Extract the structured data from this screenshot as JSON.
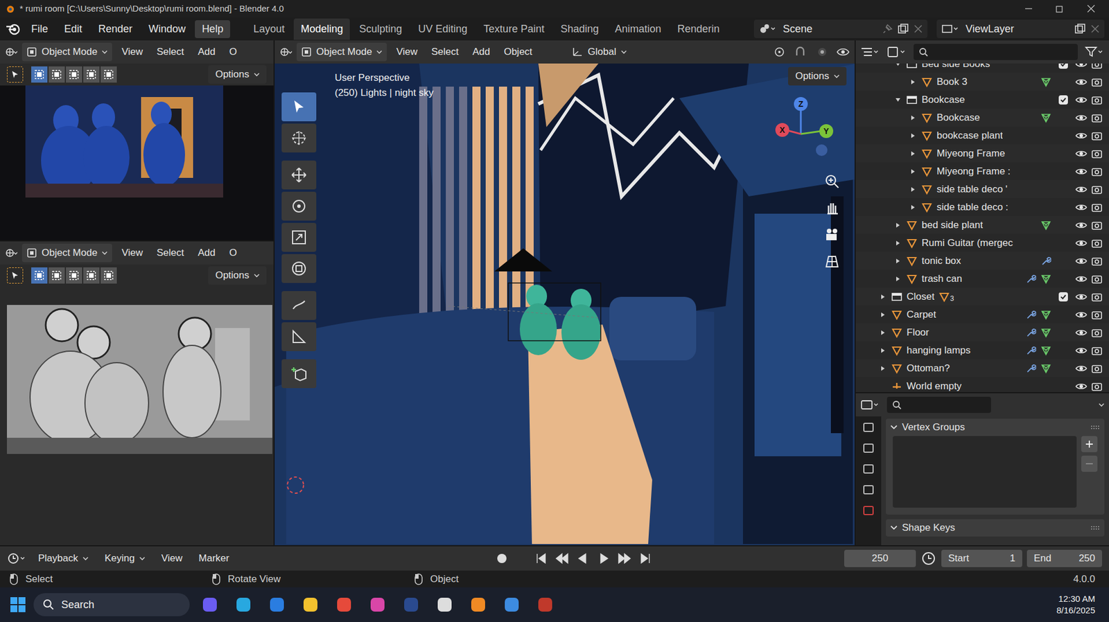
{
  "window": {
    "title": "* rumi room [C:\\Users\\Sunny\\Desktop\\rumi room.blend] - Blender 4.0"
  },
  "menu": [
    {
      "label": "File",
      "selected": false
    },
    {
      "label": "Edit",
      "selected": false
    },
    {
      "label": "Render",
      "selected": false
    },
    {
      "label": "Window",
      "selected": false
    },
    {
      "label": "Help",
      "selected": true
    }
  ],
  "workspaces": [
    {
      "label": "Layout",
      "selected": false
    },
    {
      "label": "Modeling",
      "selected": true
    },
    {
      "label": "Sculpting",
      "selected": false
    },
    {
      "label": "UV Editing",
      "selected": false
    },
    {
      "label": "Texture Paint",
      "selected": false
    },
    {
      "label": "Shading",
      "selected": false
    },
    {
      "label": "Animation",
      "selected": false
    },
    {
      "label": "Renderin",
      "selected": false
    }
  ],
  "scene": "Scene",
  "view_layer": "ViewLayer",
  "side_viewports": [
    {
      "mode": "Object Mode",
      "menus": [
        "View",
        "Select",
        "Add",
        "O"
      ],
      "options": "Options",
      "kind": "render"
    },
    {
      "mode": "Object Mode",
      "menus": [
        "View",
        "Select",
        "Add",
        "O"
      ],
      "options": "Options",
      "kind": "clay"
    }
  ],
  "main_viewport": {
    "mode": "Object Mode",
    "menus": [
      "View",
      "Select",
      "Add",
      "Object"
    ],
    "orientation": "Global",
    "options": "Options",
    "overlay": [
      "User Perspective",
      "(250) Lights | night sky"
    ],
    "gizmo": {
      "x": "X",
      "y": "Y",
      "z": "Z"
    }
  },
  "outliner": {
    "rows": [
      {
        "name": "Bed side Books",
        "depth": 1,
        "kind": "collection",
        "expandable": true,
        "expanded": true,
        "checked": true,
        "modifier": false,
        "mesh_data": false,
        "visible": true,
        "renderable": true
      },
      {
        "name": "Book 3",
        "depth": 2,
        "kind": "mesh",
        "expandable": true,
        "expanded": false,
        "modifier": false,
        "mesh_data": true,
        "visible": true,
        "renderable": true
      },
      {
        "name": "Bookcase",
        "depth": 1,
        "kind": "collection",
        "expandable": true,
        "expanded": true,
        "checked": true,
        "modifier": false,
        "mesh_data": false,
        "visible": true,
        "renderable": true
      },
      {
        "name": "Bookcase",
        "depth": 2,
        "kind": "mesh",
        "expandable": true,
        "expanded": false,
        "modifier": false,
        "mesh_data": true,
        "visible": true,
        "renderable": true
      },
      {
        "name": "bookcase plant",
        "depth": 2,
        "kind": "mesh",
        "expandable": true,
        "expanded": false,
        "modifier": false,
        "mesh_data": false,
        "visible": true,
        "renderable": true
      },
      {
        "name": "Miyeong Frame",
        "depth": 2,
        "kind": "mesh",
        "expandable": true,
        "expanded": false,
        "modifier": false,
        "mesh_data": false,
        "visible": true,
        "renderable": true
      },
      {
        "name": "Miyeong Frame :",
        "depth": 2,
        "kind": "mesh",
        "expandable": true,
        "expanded": false,
        "modifier": false,
        "mesh_data": false,
        "visible": true,
        "renderable": true
      },
      {
        "name": "side table deco '",
        "depth": 2,
        "kind": "mesh",
        "expandable": true,
        "expanded": false,
        "modifier": false,
        "mesh_data": false,
        "visible": true,
        "renderable": true
      },
      {
        "name": "side table deco :",
        "depth": 2,
        "kind": "mesh",
        "expandable": true,
        "expanded": false,
        "modifier": false,
        "mesh_data": false,
        "visible": true,
        "renderable": true
      },
      {
        "name": "bed side plant",
        "depth": 1,
        "kind": "mesh",
        "expandable": true,
        "expanded": false,
        "modifier": false,
        "mesh_data": true,
        "visible": true,
        "renderable": true
      },
      {
        "name": "Rumi Guitar (mergec",
        "depth": 1,
        "kind": "mesh",
        "expandable": true,
        "expanded": false,
        "modifier": false,
        "mesh_data": false,
        "visible": true,
        "renderable": true
      },
      {
        "name": "tonic box",
        "depth": 1,
        "kind": "mesh",
        "expandable": true,
        "expanded": false,
        "modifier": true,
        "mesh_data": false,
        "visible": true,
        "renderable": true
      },
      {
        "name": "trash can",
        "depth": 1,
        "kind": "mesh",
        "expandable": true,
        "expanded": false,
        "modifier": true,
        "mesh_data": true,
        "visible": true,
        "renderable": true
      },
      {
        "name": "Closet",
        "depth": 0,
        "kind": "collection",
        "expandable": true,
        "expanded": false,
        "checked": true,
        "count": "3",
        "modifier": false,
        "mesh_data": false,
        "visible": true,
        "renderable": true
      },
      {
        "name": "Carpet",
        "depth": 0,
        "kind": "mesh",
        "expandable": true,
        "expanded": false,
        "modifier": true,
        "mesh_data": true,
        "visible": true,
        "renderable": true
      },
      {
        "name": "Floor",
        "depth": 0,
        "kind": "mesh",
        "expandable": true,
        "expanded": false,
        "modifier": true,
        "mesh_data": true,
        "visible": true,
        "renderable": true
      },
      {
        "name": "hanging lamps",
        "depth": 0,
        "kind": "mesh",
        "expandable": true,
        "expanded": false,
        "modifier": true,
        "mesh_data": true,
        "visible": true,
        "renderable": true
      },
      {
        "name": "Ottoman?",
        "depth": 0,
        "kind": "mesh",
        "expandable": true,
        "expanded": false,
        "modifier": true,
        "mesh_data": true,
        "visible": true,
        "renderable": true
      },
      {
        "name": "World empty",
        "depth": 0,
        "kind": "empty",
        "expandable": false,
        "expanded": false,
        "modifier": false,
        "mesh_data": false,
        "visible": true,
        "renderable": true
      }
    ]
  },
  "properties": {
    "sections": [
      {
        "label": "Vertex Groups",
        "expanded": true
      },
      {
        "label": "Shape Keys",
        "expanded": true
      }
    ]
  },
  "timeline": {
    "menus": [
      "Playback",
      "Keying",
      "View",
      "Marker"
    ],
    "current_frame": "250",
    "start_label": "Start",
    "start": "1",
    "end_label": "End",
    "end": "250"
  },
  "status_bar": {
    "hints": [
      "Select",
      "Rotate View",
      "Object"
    ],
    "version": "4.0.0"
  },
  "taskbar": {
    "search": "Search",
    "time": "12:30 AM",
    "date": "8/16/2025"
  }
}
